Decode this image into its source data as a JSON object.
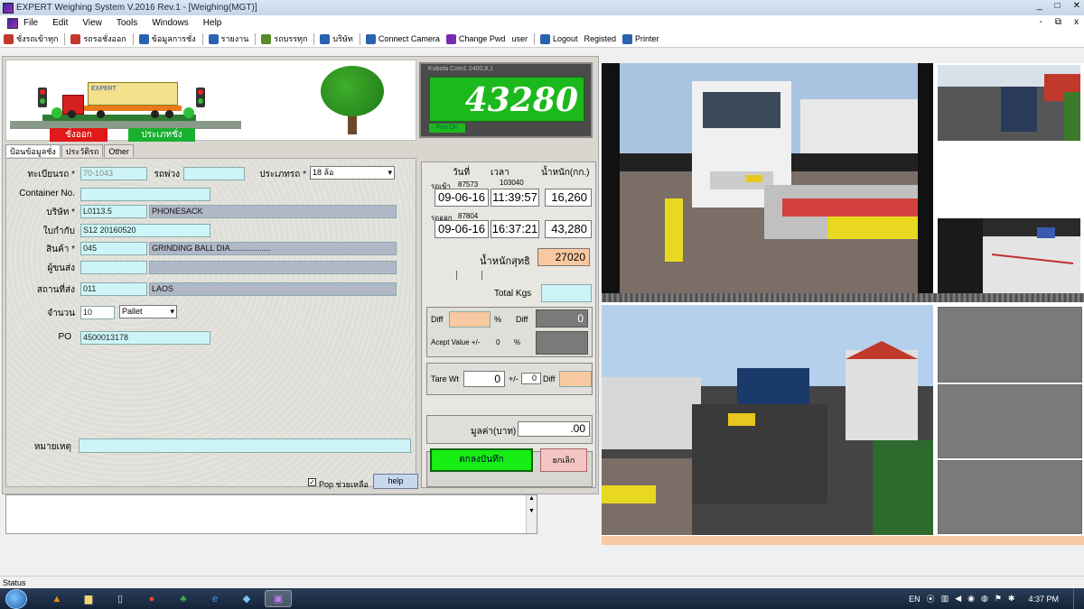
{
  "window": {
    "title": "EXPERT Weighing System V.2016 Rev.1 - [Weighing(MGT)]",
    "minimize": "_",
    "maximize": "□",
    "close": "✕"
  },
  "menu": {
    "items": [
      "File",
      "Edit",
      "View",
      "Tools",
      "Windows",
      "Help"
    ],
    "mdi_minimize": "-",
    "mdi_restore": "⧉",
    "mdi_close": "x"
  },
  "toolbar": {
    "items": [
      {
        "label": "ชั่งรถเข้าทุก",
        "icon": "truck-icon",
        "color": "#c0392b"
      },
      {
        "label": "รถรอชั่งออก",
        "icon": "truck-out-icon",
        "color": "#c0392b"
      },
      {
        "label": "ข้อมูลการชั่ง",
        "icon": "data-icon",
        "color": "#2a62b0"
      },
      {
        "label": "รายงาน",
        "icon": "report-icon",
        "color": "#2a62b0"
      },
      {
        "label": "รถบรรทุก",
        "icon": "lorry-icon",
        "color": "#5a8a2a"
      },
      {
        "label": "บริษัท",
        "icon": "company-icon",
        "color": "#2a62b0"
      },
      {
        "label": "Connect Camera",
        "icon": "camera-icon",
        "color": "#2a62b0"
      },
      {
        "label": "Change Pwd",
        "icon": "key-icon",
        "color": "#7a2ab0"
      },
      {
        "label": "user",
        "icon": "",
        "color": ""
      },
      {
        "label": "Logout",
        "icon": "logout-icon",
        "color": "#2a62b0"
      },
      {
        "label": "Registed",
        "icon": "",
        "color": ""
      },
      {
        "label": "Printer",
        "icon": "printer-icon",
        "color": "#2a62b0"
      }
    ]
  },
  "scene": {
    "out_label": "ชั่งออก",
    "type_label": "ประเภทชั่ง",
    "trailer_text": "EXPERT"
  },
  "scale": {
    "model": "Kubota Com1 2400,8,1",
    "reading": "43280",
    "status": "Port OK"
  },
  "tabs": [
    "ป้อนข้อมูลชั่ง",
    "ประวัติรถ",
    "Other"
  ],
  "form": {
    "plate_label": "ทะเบียนรถ *",
    "plate_value": "70-1043",
    "trailer_label": "รถพ่วง",
    "trailer_value": "",
    "truck_type_label": "ประเภทรถ *",
    "truck_type_value": "18 ล้อ",
    "container_label": "Container No.",
    "container_value": "",
    "company_label": "บริษัท *",
    "company_code": "L0113.5",
    "company_name": "PHONESACK",
    "ticket_label": "ใบกำกับ",
    "ticket_value": "S12 20160520",
    "product_label": "สินค้า *",
    "product_code": "045",
    "product_name": "GRINDING BALL DIA..................",
    "shipper_label": "ผู้ขนส่ง",
    "shipper_code": "",
    "shipper_name": "",
    "location_label": "สถานที่ส่ง",
    "location_code": "011",
    "location_name": "LAOS",
    "qty_label": "จำนวน",
    "qty_value": "10",
    "unit_value": "Pallet",
    "po_label": "PO",
    "po_value": "4500013178",
    "pop_label": "Pop ช่วยเหลือ",
    "pop_check": "✓",
    "help_label": "help",
    "remark_label": "หมายเหตุ",
    "remark_value": ""
  },
  "weights": {
    "col_date": "วันที่",
    "col_time": "เวลา",
    "col_weight": "น้ำหนัก(กก.)",
    "in_label": "รถเข้า",
    "in_id": "87573",
    "in_ref": "103040",
    "in_date": "09-06-16",
    "in_time": "11:39:57",
    "in_weight": "16,260",
    "out_label": "รถออก",
    "out_id": "87804",
    "out_date": "09-06-16",
    "out_time": "16:37:21",
    "out_weight": "43,280",
    "net_label": "น้ำหนักสุทธิ",
    "net_value": "27020",
    "total_label": "Total Kgs",
    "total_value": "",
    "diff_label": "Diff",
    "pct_label": "%",
    "diff2_label": "Diff",
    "diff_value": "0",
    "accept_label": "Acept Value +/-",
    "accept_value": "0",
    "accept_pct": "%",
    "tare_label": "Tare Wt",
    "tare_value": "0",
    "tare_pm": "+/-",
    "tare_pm_value": "0",
    "tare_diff": "Diff",
    "price_label": "มูลค่า(บาท)",
    "price_value": ".00",
    "save_label": "ตกลงบันทึก",
    "cancel_label": "ยกเลิก"
  },
  "status": {
    "text": "Status"
  },
  "taskbar": {
    "lang": "EN",
    "time": "4:37 PM"
  }
}
